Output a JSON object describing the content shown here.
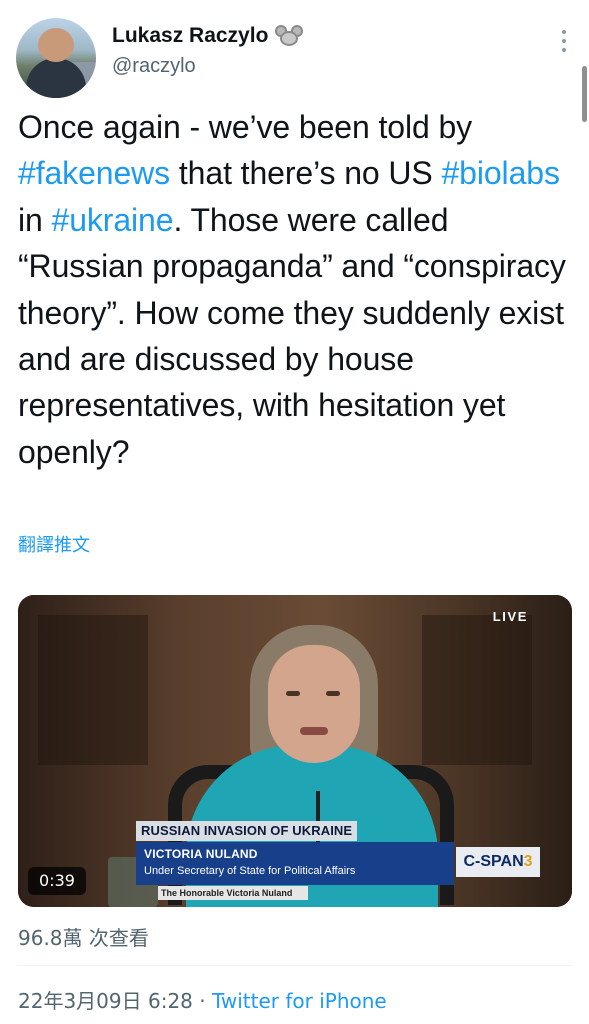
{
  "author": {
    "display_name": "Lukasz Raczylo",
    "handle": "@raczylo",
    "badge_icon": "mouse-face-icon"
  },
  "tweet": {
    "segments": [
      {
        "text": "Once again - we’ve been told by ",
        "type": "text"
      },
      {
        "text": "#fakenews",
        "type": "hashtag"
      },
      {
        "text": " that there’s no US ",
        "type": "text"
      },
      {
        "text": "#biolabs",
        "type": "hashtag"
      },
      {
        "text": " in ",
        "type": "text"
      },
      {
        "text": "#ukraine",
        "type": "hashtag"
      },
      {
        "text": ". Those were called “Russian propaganda” and “conspiracy theory”. How come they suddenly exist and are discussed by house representatives, with hesitation yet openly?",
        "type": "text"
      }
    ],
    "translate_label": "翻譯推文"
  },
  "video": {
    "live_label": "LIVE",
    "chyron_title": "RUSSIAN INVASION OF UKRAINE",
    "speaker_name": "VICTORIA NULAND",
    "speaker_title": "Under Secretary of State for Political Affairs",
    "nameplate": "The Honorable Victoria Nuland",
    "network": "C-SPAN",
    "network_number": "3",
    "duration": "0:39"
  },
  "stats": {
    "views": "96.8萬 次查看"
  },
  "meta": {
    "timestamp": "22年3月09日 6:28",
    "separator": " · ",
    "source": "Twitter for iPhone"
  },
  "colors": {
    "link": "#1d9bf0",
    "secondary_text": "#536471",
    "primary_text": "#0f1419"
  }
}
